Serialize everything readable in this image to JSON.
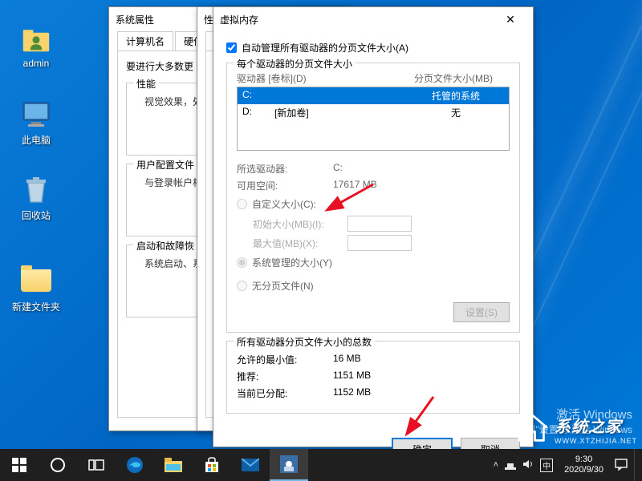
{
  "desktop": {
    "icons": [
      {
        "name": "admin",
        "label": "admin"
      },
      {
        "name": "this-pc",
        "label": "此电脑"
      },
      {
        "name": "recycle-bin",
        "label": "回收站"
      },
      {
        "name": "new-folder",
        "label": "新建文件夹"
      }
    ]
  },
  "window1": {
    "title": "系统属性",
    "tabs": [
      "计算机名",
      "硬件"
    ],
    "section1": {
      "heading": "要进行大多数更",
      "sub_title": "性能",
      "sub_text": "视觉效果，处"
    },
    "section2": {
      "heading": "用户配置文件",
      "text": "与登录帐户相"
    },
    "section3": {
      "heading": "启动和故障恢",
      "text": "系统启动、系"
    }
  },
  "window2": {
    "title": "性",
    "tab": "视"
  },
  "window3": {
    "title": "虚拟内存",
    "auto_manage_label": "自动管理所有驱动器的分页文件大小(A)",
    "auto_manage_checked": true,
    "per_drive_heading": "每个驱动器的分页文件大小",
    "col_drive": "驱动器 [卷标](D)",
    "col_size": "分页文件大小(MB)",
    "drives": [
      {
        "letter": "C:",
        "label": "",
        "size": "托管的系统",
        "selected": true
      },
      {
        "letter": "D:",
        "label": "[新加卷]",
        "size": "无",
        "selected": false
      }
    ],
    "selected_drive_label": "所选驱动器:",
    "selected_drive_value": "C:",
    "free_space_label": "可用空间:",
    "free_space_value": "17617 MB",
    "radio_custom": "自定义大小(C):",
    "initial_label": "初始大小(MB)(I):",
    "max_label": "最大值(MB)(X):",
    "radio_system": "系统管理的大小(Y)",
    "radio_none": "无分页文件(N)",
    "set_button": "设置(S)",
    "totals_heading": "所有驱动器分页文件大小的总数",
    "min_label": "允许的最小值:",
    "min_value": "16 MB",
    "rec_label": "推荐:",
    "rec_value": "1151 MB",
    "cur_label": "当前已分配:",
    "cur_value": "1152 MB",
    "ok": "确定",
    "cancel": "取消"
  },
  "watermark": {
    "line1": "激活 Windows",
    "line2": "转到\"设置\"以激活 Windows"
  },
  "brand": {
    "text": "系统之家",
    "sub": "WWW.XTZHIJIA.NET"
  },
  "taskbar": {
    "time": "9:30",
    "date": "2020/9/30"
  }
}
